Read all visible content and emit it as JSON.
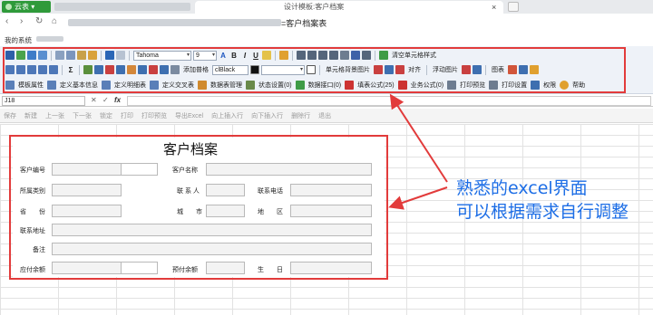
{
  "browser": {
    "app_label": "云表",
    "tab_title": "设计模板:客户档案",
    "url_suffix": "=客户档案表",
    "close_glyph": "×",
    "bookmark": "我的系统"
  },
  "toolbar": {
    "font_name": "Tahoma",
    "font_size": "9",
    "bold": "B",
    "italic": "I",
    "underline": "U",
    "clear_format": "清空单元格样式",
    "add_table": "添加普格",
    "color_name": "clBlack",
    "cell_bg_image": "单元格背景图片",
    "align": "对齐",
    "float_image": "浮动图片",
    "chart": "图表",
    "row3": [
      "模板属性",
      "定义基本信息",
      "定义明细表",
      "定义交叉表",
      "数据表管理",
      "状态设置(0)",
      "数据接口(0)",
      "填表公式(25)",
      "业务公式(0)",
      "打印预览",
      "打印设置",
      "权限",
      "帮助"
    ]
  },
  "formula_bar": {
    "cell_ref": "J18",
    "fx": "fx",
    "value": ""
  },
  "action_bar": [
    "保存",
    "新建",
    "上一张",
    "下一张",
    "锁定",
    "打印",
    "打印预览",
    "导出Excel",
    "向上插入行",
    "向下插入行",
    "删除行",
    "退出"
  ],
  "form": {
    "title": "客户档案",
    "labels": {
      "customer_no": "客户编号",
      "customer_name": "客户名称",
      "category": "所属类别",
      "contact": "联 系 人",
      "phone": "联系电话",
      "province": "省　　份",
      "city": "城　　市",
      "region": "地　　区",
      "address": "联系地址",
      "remark": "备注",
      "payable": "应付余额",
      "prepaid": "预付余额",
      "birthday": "生　　日"
    }
  },
  "annotation": {
    "line1": "熟悉的excel界面",
    "line2": "可以根据需求自行调整",
    "color": "#1d6ee6",
    "box_color": "#e23b3b"
  }
}
